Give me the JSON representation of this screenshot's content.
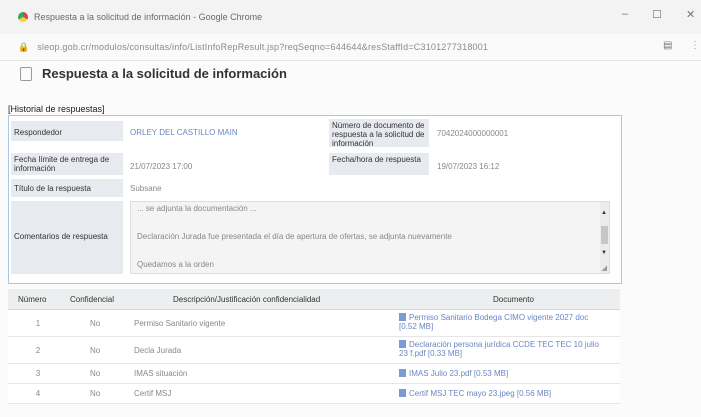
{
  "window": {
    "title": "Respuesta a la solicitud de información - Google Chrome",
    "minimize_glyph": "–",
    "maximize_glyph": "☐",
    "close_glyph": "✕",
    "url": "sleop.gob.cr/modulos/consultas/info/ListInfoRepResult.jsp?reqSeqno=644644&resStaffId=C3101277318001"
  },
  "page": {
    "title": "Respuesta a la solicitud de información",
    "history_label": "[Historial de respuestas]"
  },
  "details": {
    "responder_label": "Respondedor",
    "responder_value": "ORLEY DEL CASTILLO MAIN",
    "doc_number_label": "Número de documento de respuesta a la solicitud de información",
    "doc_number_value": "7042024000000001",
    "deadline_label": "Fecha límite de entrega de información",
    "deadline_value": "21/07/2023 17:00",
    "response_date_label": "Fecha/hora de respuesta",
    "response_date_value": "19/07/2023 16:12",
    "response_title_label": "Título de la respuesta",
    "response_title_value": "Subsane",
    "comments_label": "Comentarios de respuesta",
    "comments_line1": "... se adjunta la documentación ...",
    "comments_line2": "Declaración Jurada fue presentada el día de apertura de ofertas, se adjunta nuevamente",
    "comments_line3": "Quedamos a la orden"
  },
  "table": {
    "headers": [
      "Número",
      "Confidencial",
      "Descripción/Justificación confidencialidad",
      "Documento"
    ],
    "rows": [
      {
        "num": "1",
        "conf": "No",
        "desc": "Permiso Sanitario vigente",
        "doc": "Permiso Sanitario Bodega CIMO vigente 2027 doc [0.52 MB]"
      },
      {
        "num": "2",
        "conf": "No",
        "desc": "Decla Jurada",
        "doc": "Declaración persona jurídica CCDE TEC TEC 10 julio 23 f.pdf [0.33 MB]"
      },
      {
        "num": "3",
        "conf": "No",
        "desc": "IMAS situación",
        "doc": "IMAS Julio 23.pdf [0.53 MB]"
      },
      {
        "num": "4",
        "conf": "No",
        "desc": "Certif MSJ",
        "doc": "Certif MSJ TEC mayo 23.jpeg [0.56 MB]"
      }
    ]
  }
}
